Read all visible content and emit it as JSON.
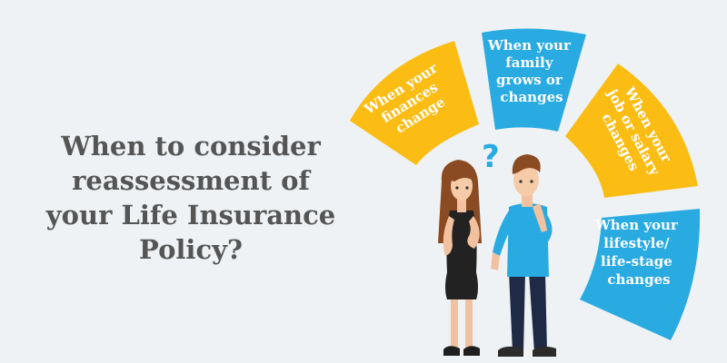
{
  "headline": {
    "lines": [
      "When to consider",
      "reassessment of",
      "your Life Insurance",
      "Policy?"
    ]
  },
  "segments": [
    {
      "lines": [
        "When your",
        "finances",
        "change"
      ],
      "color": "#fbbd14"
    },
    {
      "lines": [
        "When your",
        "family",
        "grows or",
        "changes"
      ],
      "color": "#29abe2"
    },
    {
      "lines": [
        "When your",
        "job or salary",
        "changes"
      ],
      "color": "#fbbd14"
    },
    {
      "lines": [
        "When your",
        "lifestyle/",
        "life-stage",
        "changes"
      ],
      "color": "#29abe2"
    }
  ],
  "question_mark": "?",
  "colors": {
    "background": "#eef2f4",
    "headline": "#555555",
    "yellow": "#fbbd14",
    "blue": "#29abe2"
  }
}
